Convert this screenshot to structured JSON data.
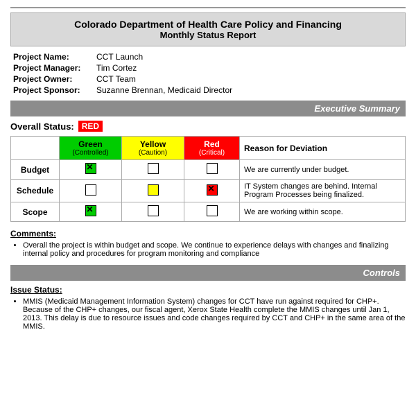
{
  "header": {
    "title_main": "Colorado Department of Health Care Policy and Financing",
    "title_sub": "Monthly Status Report"
  },
  "project_info": {
    "name_label": "Project Name:",
    "name_value": "CCT Launch",
    "manager_label": "Project Manager:",
    "manager_value": "Tim Cortez",
    "owner_label": "Project Owner:",
    "owner_value": "CCT Team",
    "sponsor_label": "Project Sponsor:",
    "sponsor_value": "Suzanne Brennan, Medicaid Director"
  },
  "executive_summary": {
    "label": "Executive Summary"
  },
  "overall_status": {
    "label": "Overall Status:",
    "value": "RED"
  },
  "status_table": {
    "columns": {
      "green": "Green",
      "green_sub": "(Controlled)",
      "yellow": "Yellow",
      "yellow_sub": "(Caution)",
      "red": "Red",
      "red_sub": "(Critical)",
      "reason": "Reason for Deviation"
    },
    "rows": [
      {
        "label": "Budget",
        "green": "checked",
        "yellow": "empty",
        "red": "empty",
        "reason": "We are currently under budget."
      },
      {
        "label": "Schedule",
        "green": "empty",
        "yellow": "yellow",
        "red": "red-checked",
        "reason": "IT System changes are behind. Internal Program Processes being finalized."
      },
      {
        "label": "Scope",
        "green": "checked",
        "yellow": "empty",
        "red": "empty",
        "reason": "We are working within scope."
      }
    ]
  },
  "comments": {
    "label": "Comments:",
    "items": [
      "Overall the project is within budget and scope.  We continue to experience delays with changes and finalizing internal policy and procedures for program monitoring and compliance"
    ]
  },
  "controls": {
    "label": "Controls"
  },
  "issue_status": {
    "label": "Issue Status:",
    "items": [
      "MMIS (Medicaid Management Information System) changes for CCT have run against required for CHP+. Because of the CHP+ changes, our fiscal agent, Xerox State Health complete the MMIS changes until Jan 1, 2013.  This delay is due to resource issues and code changes required by CCT and CHP+ in the same area of the MMIS."
    ]
  }
}
